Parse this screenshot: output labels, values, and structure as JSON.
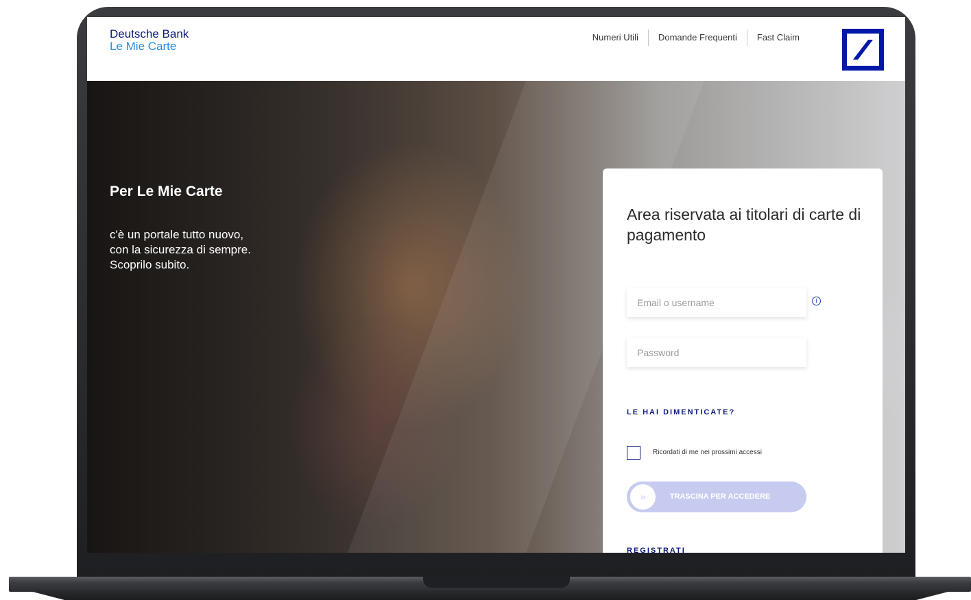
{
  "header": {
    "brand_line1": "Deutsche Bank",
    "brand_line2": "Le Mie Carte",
    "nav": [
      "Numeri Utili",
      "Domande Frequenti",
      "Fast Claim"
    ],
    "logo_icon": "deutsche-bank-logo"
  },
  "hero": {
    "title": "Per Le Mie Carte",
    "text_lines": [
      "c'è un portale tutto nuovo,",
      "con la sicurezza di sempre.",
      "Scoprilo subito."
    ]
  },
  "login": {
    "title": "Area riservata ai titolari di carte di pagamento",
    "email_placeholder": "Email o username",
    "password_placeholder": "Password",
    "info_icon": "info-icon",
    "forgot_label": "LE HAI DIMENTICATE?",
    "remember_label": "Ricordati di me nei prossimi accessi",
    "slider_label": "TRASCINA PER ACCEDERE",
    "slider_handle_glyph": "»",
    "register_label": "REGISTRATI"
  },
  "colors": {
    "brand_blue": "#0018a8",
    "dark_navy": "#0c1a7a",
    "light_blue": "#2a8be0",
    "slider_bg": "#c8cbf0"
  }
}
